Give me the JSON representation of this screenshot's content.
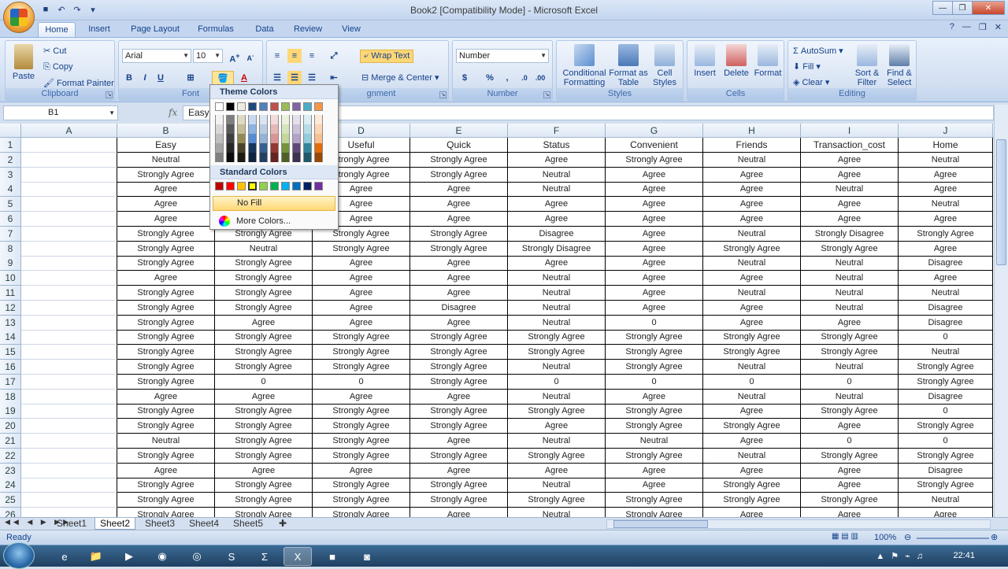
{
  "window": {
    "title": "Book2  [Compatibility Mode] - Microsoft Excel"
  },
  "tabs": [
    "Home",
    "Insert",
    "Page Layout",
    "Formulas",
    "Data",
    "Review",
    "View"
  ],
  "clipboard": {
    "paste": "Paste",
    "cut": "Cut",
    "copy": "Copy",
    "format_painter": "Format Painter",
    "label": "Clipboard"
  },
  "font": {
    "name": "Arial",
    "size": "10",
    "label": "Font",
    "bold": "B",
    "italic": "I",
    "underline": "U"
  },
  "alignment": {
    "wrap": "Wrap Text",
    "merge": "Merge & Center",
    "label": "Alignment",
    "label_visible": "gnment"
  },
  "number": {
    "format": "Number",
    "label": "Number",
    "percent": "%",
    "comma": ","
  },
  "styles": {
    "conditional": "Conditional Formatting",
    "format_table": "Format as Table",
    "cell_styles": "Cell Styles",
    "label": "Styles"
  },
  "cells": {
    "insert": "Insert",
    "delete": "Delete",
    "format": "Format",
    "label": "Cells"
  },
  "editing": {
    "autosum": "AutoSum",
    "fill": "Fill",
    "clear": "Clear",
    "sort": "Sort & Filter",
    "find": "Find & Select",
    "label": "Editing"
  },
  "namebox": "B1",
  "formula": "Easy",
  "fx": "fx",
  "columns": [
    "A",
    "B",
    "C",
    "D",
    "E",
    "F",
    "G",
    "H",
    "I",
    "J"
  ],
  "rows": [
    [
      "1",
      "",
      "Easy",
      "",
      "Useful",
      "Quick",
      "Status",
      "Convenient",
      "Friends",
      "Transaction_cost",
      "Home"
    ],
    [
      "2",
      "",
      "Neutral",
      "Strongly Agree",
      "Strongly Agree",
      "Strongly Agree",
      "Agree",
      "Strongly Agree",
      "Neutral",
      "Agree",
      "Neutral"
    ],
    [
      "3",
      "",
      "Strongly Agree",
      "Strongly Agree",
      "Strongly Agree",
      "Strongly Agree",
      "Neutral",
      "Agree",
      "Agree",
      "Agree",
      "Agree"
    ],
    [
      "4",
      "",
      "Agree",
      "Agree",
      "Agree",
      "Agree",
      "Neutral",
      "Agree",
      "Agree",
      "Neutral",
      "Agree"
    ],
    [
      "5",
      "",
      "Agree",
      "Agree",
      "Agree",
      "Agree",
      "Agree",
      "Agree",
      "Agree",
      "Agree",
      "Neutral"
    ],
    [
      "6",
      "",
      "Agree",
      "Agree",
      "Agree",
      "Agree",
      "Agree",
      "Agree",
      "Agree",
      "Agree",
      "Agree"
    ],
    [
      "7",
      "",
      "Strongly Agree",
      "Strongly Agree",
      "Strongly Agree",
      "Strongly Agree",
      "Disagree",
      "Agree",
      "Neutral",
      "Strongly Disagree",
      "Strongly Agree"
    ],
    [
      "8",
      "",
      "Strongly Agree",
      "Neutral",
      "Strongly Agree",
      "Strongly Agree",
      "Strongly Disagree",
      "Agree",
      "Strongly Agree",
      "Strongly Agree",
      "Agree"
    ],
    [
      "9",
      "",
      "Strongly Agree",
      "Strongly Agree",
      "Agree",
      "Agree",
      "Agree",
      "Agree",
      "Neutral",
      "Neutral",
      "Disagree"
    ],
    [
      "10",
      "",
      "Agree",
      "Strongly Agree",
      "Agree",
      "Agree",
      "Neutral",
      "Agree",
      "Agree",
      "Neutral",
      "Agree"
    ],
    [
      "11",
      "",
      "Strongly Agree",
      "Strongly Agree",
      "Agree",
      "Agree",
      "Neutral",
      "Agree",
      "Neutral",
      "Neutral",
      "Neutral"
    ],
    [
      "12",
      "",
      "Strongly Agree",
      "Strongly Agree",
      "Agree",
      "Disagree",
      "Neutral",
      "Agree",
      "Agree",
      "Neutral",
      "Disagree"
    ],
    [
      "13",
      "",
      "Strongly Agree",
      "Agree",
      "Agree",
      "Agree",
      "Neutral",
      "0",
      "Agree",
      "Agree",
      "Disagree"
    ],
    [
      "14",
      "",
      "Strongly Agree",
      "Strongly Agree",
      "Strongly Agree",
      "Strongly Agree",
      "Strongly Agree",
      "Strongly Agree",
      "Strongly Agree",
      "Strongly Agree",
      "0"
    ],
    [
      "15",
      "",
      "Strongly Agree",
      "Strongly Agree",
      "Strongly Agree",
      "Strongly Agree",
      "Strongly Agree",
      "Strongly Agree",
      "Strongly Agree",
      "Strongly Agree",
      "Neutral"
    ],
    [
      "16",
      "",
      "Strongly Agree",
      "Strongly Agree",
      "Strongly Agree",
      "Strongly Agree",
      "Neutral",
      "Strongly Agree",
      "Neutral",
      "Neutral",
      "Strongly Agree"
    ],
    [
      "17",
      "",
      "Strongly Agree",
      "0",
      "0",
      "Strongly Agree",
      "0",
      "0",
      "0",
      "0",
      "Strongly Agree"
    ],
    [
      "18",
      "",
      "Agree",
      "Agree",
      "Agree",
      "Agree",
      "Neutral",
      "Agree",
      "Neutral",
      "Neutral",
      "Disagree"
    ],
    [
      "19",
      "",
      "Strongly Agree",
      "Strongly Agree",
      "Strongly Agree",
      "Strongly Agree",
      "Strongly Agree",
      "Strongly Agree",
      "Agree",
      "Strongly Agree",
      "0"
    ],
    [
      "20",
      "",
      "Strongly Agree",
      "Strongly Agree",
      "Strongly Agree",
      "Strongly Agree",
      "Agree",
      "Strongly Agree",
      "Strongly Agree",
      "Agree",
      "Strongly Agree"
    ],
    [
      "21",
      "",
      "Neutral",
      "Strongly Agree",
      "Strongly Agree",
      "Agree",
      "Neutral",
      "Neutral",
      "Agree",
      "0",
      "0"
    ],
    [
      "22",
      "",
      "Strongly Agree",
      "Strongly Agree",
      "Strongly Agree",
      "Strongly Agree",
      "Strongly Agree",
      "Strongly Agree",
      "Neutral",
      "Strongly Agree",
      "Strongly Agree"
    ],
    [
      "23",
      "",
      "Agree",
      "Agree",
      "Agree",
      "Agree",
      "Agree",
      "Agree",
      "Agree",
      "Agree",
      "Disagree"
    ],
    [
      "24",
      "",
      "Strongly Agree",
      "Strongly Agree",
      "Strongly Agree",
      "Strongly Agree",
      "Neutral",
      "Agree",
      "Strongly Agree",
      "Agree",
      "Strongly Agree"
    ],
    [
      "25",
      "",
      "Strongly Agree",
      "Strongly Agree",
      "Strongly Agree",
      "Strongly Agree",
      "Strongly Agree",
      "Strongly Agree",
      "Strongly Agree",
      "Strongly Agree",
      "Neutral"
    ],
    [
      "26",
      "",
      "Strongly Agree",
      "Strongly Agree",
      "Strongly Agree",
      "Agree",
      "Neutral",
      "Strongly Agree",
      "Agree",
      "Agree",
      "Agree"
    ]
  ],
  "sheets": [
    "Sheet1",
    "Sheet2",
    "Sheet3",
    "Sheet4",
    "Sheet5"
  ],
  "active_sheet": "Sheet2",
  "status": {
    "ready": "Ready",
    "zoom": "100%"
  },
  "clock": "22:41",
  "palette": {
    "theme_title": "Theme Colors",
    "standard_title": "Standard Colors",
    "no_fill": "No Fill",
    "more_colors": "More Colors...",
    "theme_top": [
      "#ffffff",
      "#000000",
      "#eeece1",
      "#1f497d",
      "#4f81bd",
      "#c0504d",
      "#9bbb59",
      "#8064a2",
      "#4bacc6",
      "#f79646"
    ],
    "theme_shades": [
      [
        "#f2f2f2",
        "#7f7f7f",
        "#ddd9c3",
        "#c6d9f0",
        "#dbe5f1",
        "#f2dcdb",
        "#ebf1dd",
        "#e5e0ec",
        "#dbeef3",
        "#fdeada"
      ],
      [
        "#d8d8d8",
        "#595959",
        "#c4bd97",
        "#8db3e2",
        "#b8cce4",
        "#e5b9b7",
        "#d7e3bc",
        "#ccc1d9",
        "#b7dde8",
        "#fbd5b5"
      ],
      [
        "#bfbfbf",
        "#3f3f3f",
        "#938953",
        "#548dd4",
        "#95b3d7",
        "#d99694",
        "#c3d69b",
        "#b2a2c7",
        "#92cddc",
        "#fac08f"
      ],
      [
        "#a5a5a5",
        "#262626",
        "#494429",
        "#17365d",
        "#366092",
        "#953734",
        "#76923c",
        "#5f497a",
        "#31859b",
        "#e36c09"
      ],
      [
        "#7f7f7f",
        "#0c0c0c",
        "#1d1b10",
        "#0f243e",
        "#244061",
        "#632423",
        "#4f6128",
        "#3f3151",
        "#205867",
        "#974806"
      ]
    ],
    "standard": [
      "#c00000",
      "#ff0000",
      "#ffc000",
      "#ffff00",
      "#92d050",
      "#00b050",
      "#00b0f0",
      "#0070c0",
      "#002060",
      "#7030a0"
    ]
  }
}
